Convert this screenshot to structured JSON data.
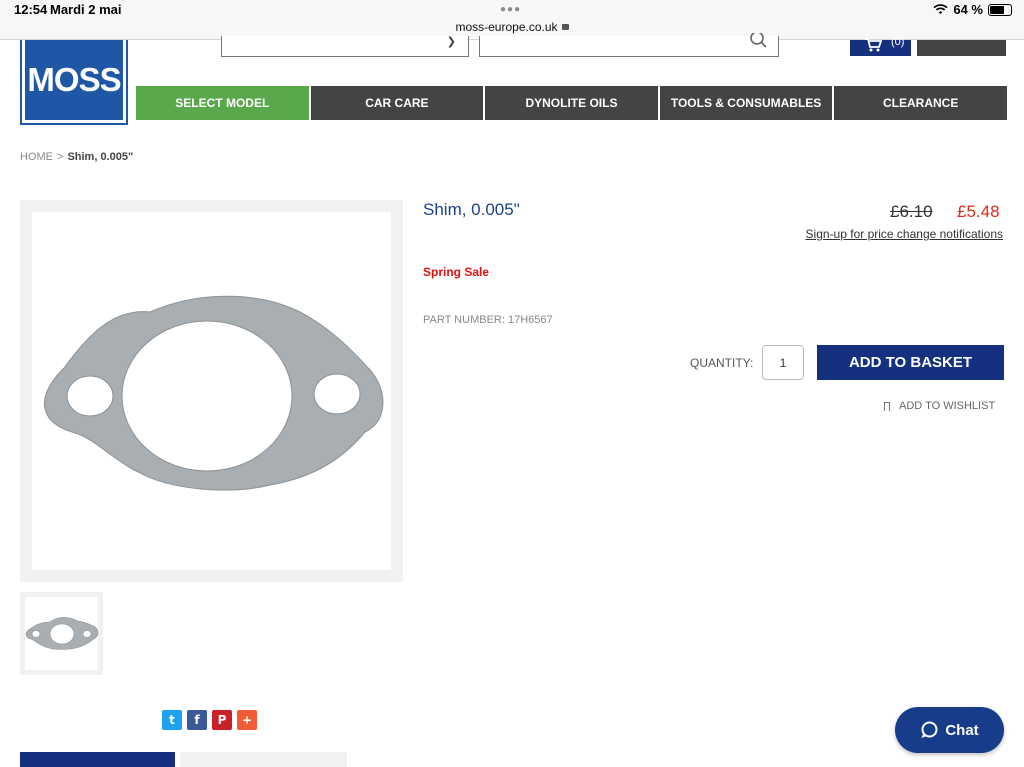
{
  "status_bar": {
    "time": "12:54",
    "date": "Mardi 2 mai",
    "url": "moss-europe.co.uk",
    "battery": "64 %",
    "battery_level": 0.64
  },
  "header": {
    "logo_text": "MOSS",
    "cart_count": "(0)"
  },
  "nav": [
    {
      "label": "SELECT MODEL"
    },
    {
      "label": "CAR CARE"
    },
    {
      "label": "DYNOLITE OILS"
    },
    {
      "label": "TOOLS & CONSUMABLES"
    },
    {
      "label": "CLEARANCE"
    }
  ],
  "breadcrumb": {
    "home": "HOME",
    "separator": ">",
    "current": "Shim, 0.005\""
  },
  "product": {
    "title": "Shim, 0.005\"",
    "old_price": "£6.10",
    "price": "£5.48",
    "notify_text": "Sign-up for price change notifications",
    "sale_label": "Spring Sale",
    "part_number": "PART NUMBER: 17H6567",
    "quantity_label": "QUANTITY:",
    "quantity": "1",
    "add_to_basket": "ADD TO BASKET",
    "add_to_wishlist": "ADD TO WISHLIST"
  },
  "share": {
    "twitter": "t",
    "facebook": "f",
    "pinterest": "P",
    "more": "+"
  },
  "chat_label": "Chat",
  "colors": {
    "brand_blue": "#14307f",
    "nav_active": "#59a84b",
    "nav_bg": "#444444",
    "sale_red": "#e32b1b",
    "twitter": "#1da1f2",
    "facebook": "#3b5998",
    "pinterest": "#cb2027",
    "more": "#f05d35"
  }
}
